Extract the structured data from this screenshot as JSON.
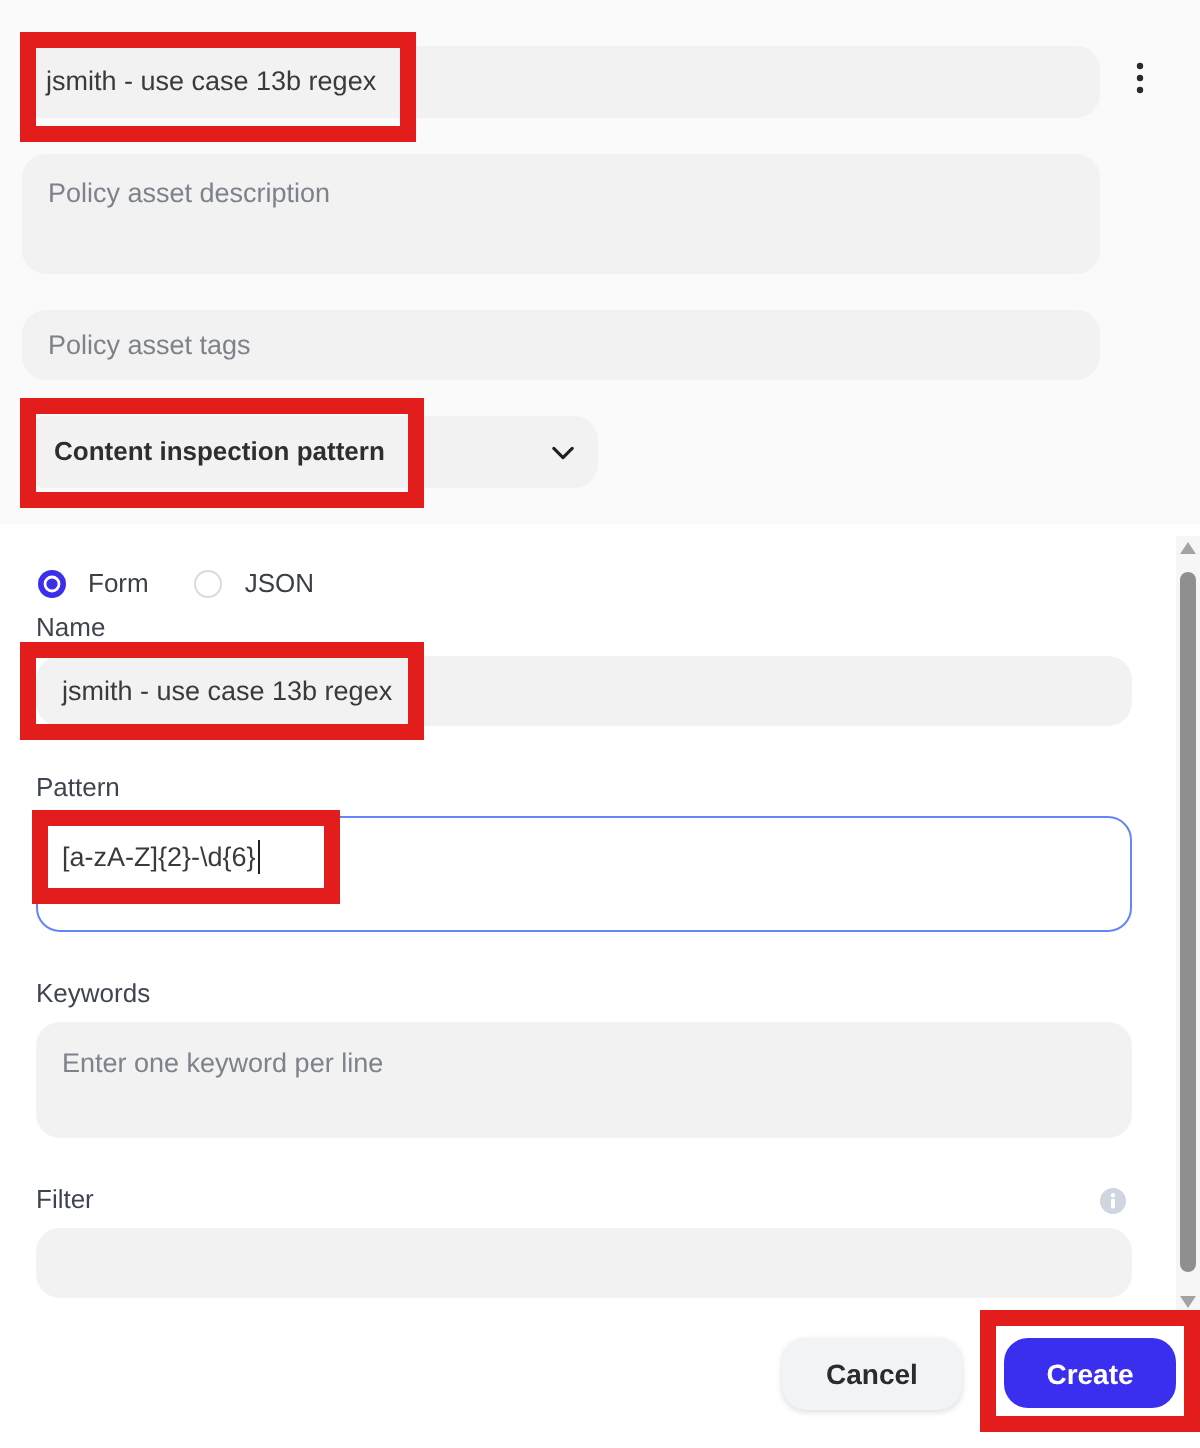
{
  "asset_fields": [
    {
      "kind": "input",
      "value": "jsmith - use case 13b regex",
      "highlighted": true
    },
    {
      "kind": "textarea",
      "placeholder": "Policy asset description",
      "highlighted": false
    },
    {
      "kind": "input",
      "placeholder": "Policy asset tags",
      "highlighted": false
    },
    {
      "kind": "select",
      "value": "Content inspection pattern",
      "highlighted": true
    }
  ],
  "mode_options": [
    {
      "label": "Form",
      "selected": true
    },
    {
      "label": "JSON",
      "selected": false
    }
  ],
  "fields": [
    {
      "kind": "input",
      "label": "Name",
      "value": "jsmith - use case 13b regex",
      "focused": false,
      "highlighted": true,
      "info": false
    },
    {
      "kind": "textarea",
      "label": "Pattern",
      "value": "[a-zA-Z]{2}-\\d{6}",
      "focused": true,
      "highlighted": true,
      "info": false
    },
    {
      "kind": "textarea",
      "label": "Keywords",
      "placeholder": "Enter one keyword per line",
      "focused": false,
      "highlighted": false,
      "info": false
    },
    {
      "kind": "input",
      "label": "Filter",
      "focused": false,
      "highlighted": false,
      "info": true
    }
  ],
  "buttons": [
    {
      "label": "Cancel",
      "kind": "secondary",
      "highlighted": false
    },
    {
      "label": "Create",
      "kind": "primary",
      "highlighted": true
    }
  ]
}
